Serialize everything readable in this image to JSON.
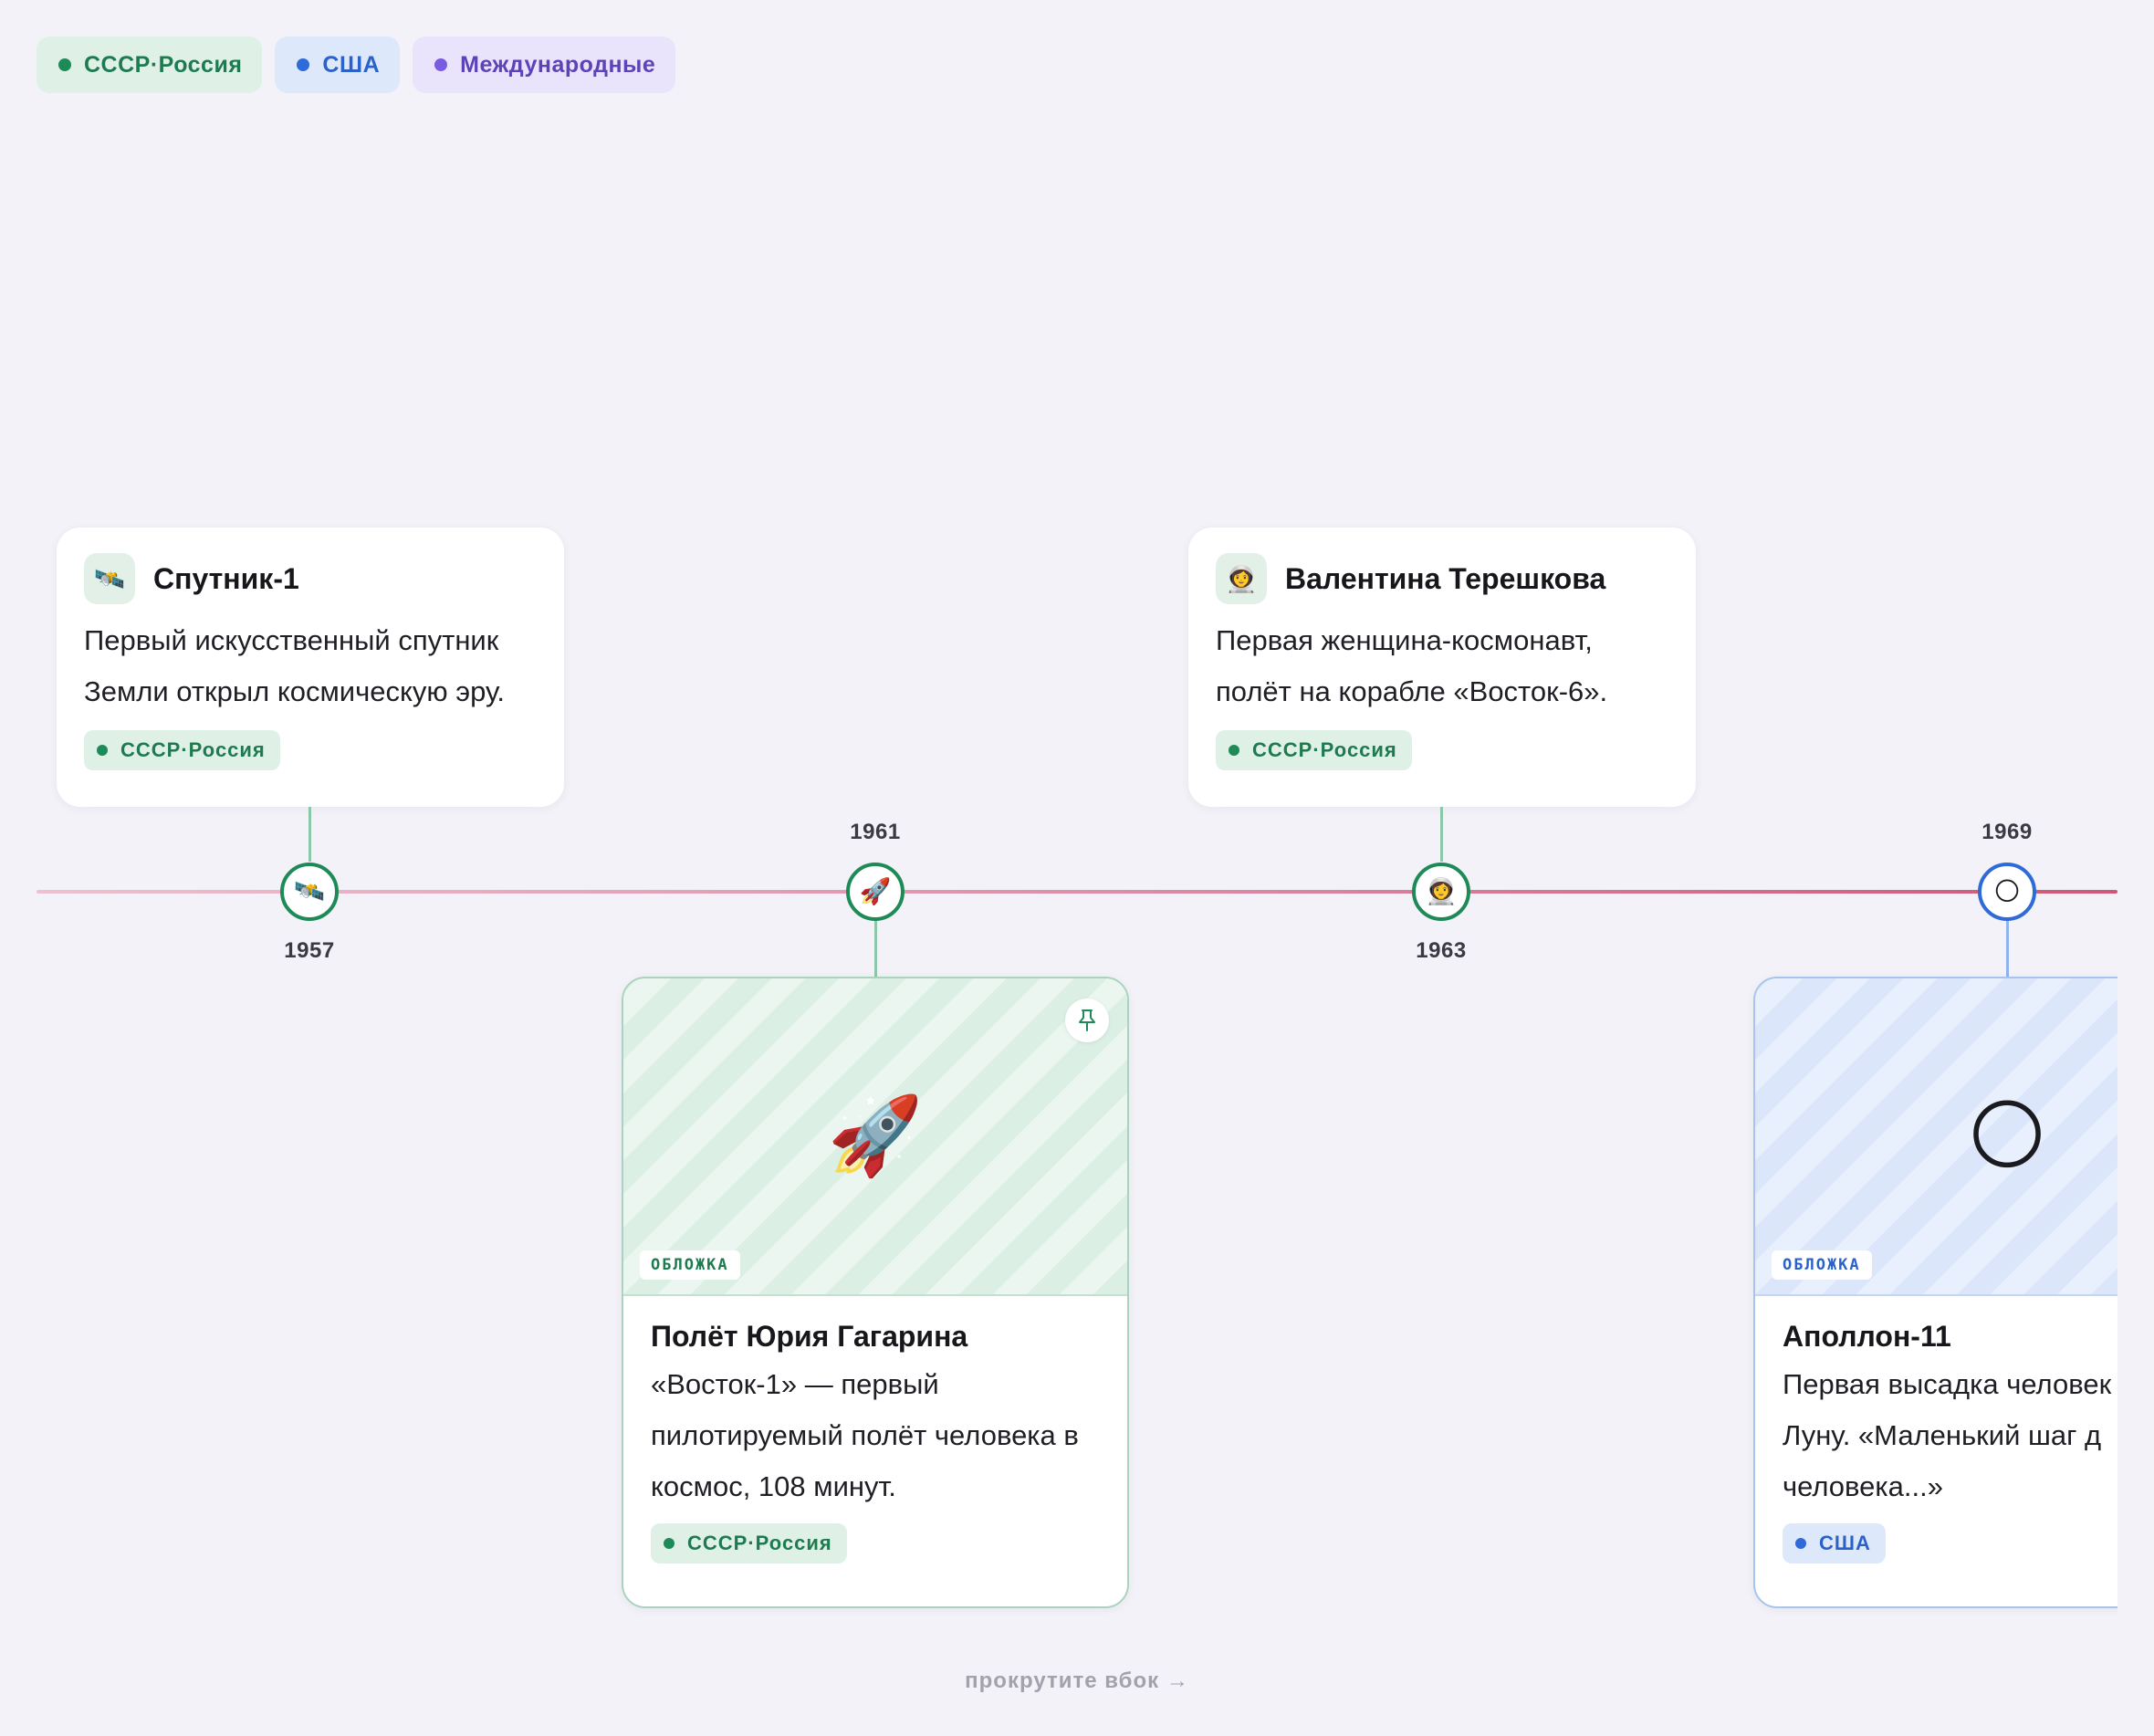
{
  "legend": [
    {
      "label": "СССР·Россия",
      "color": "#1e8a57"
    },
    {
      "label": "США",
      "color": "#2f6ad9"
    },
    {
      "label": "Международные",
      "color": "#7a5ce0"
    }
  ],
  "events": [
    {
      "year": "1957",
      "icon": "satellite-icon",
      "emoji": "🛰️",
      "title": "Спутник-1",
      "description": "Первый искусственный спутник Земли открыл космическую эру.",
      "tag": "СССР·Россия"
    },
    {
      "year": "1961",
      "icon": "rocket-icon",
      "emoji": "🚀",
      "cover_label": "ОБЛОЖКА",
      "title": "Полёт Юрия Гагарина",
      "description": "«Восток-1» — первый пилотируемый полёт человека в космос, 108 минут.",
      "tag": "СССР·Россия"
    },
    {
      "year": "1963",
      "icon": "astronaut-icon",
      "emoji": "👩‍🚀",
      "title": "Валентина Терешкова",
      "description": "Первая женщина-космонавт, полёт на корабле «Восток-6».",
      "tag": "СССР·Россия"
    },
    {
      "year": "1969",
      "icon": "moon-icon",
      "emoji": "🌕",
      "cover_label": "ОБЛОЖКА",
      "title": "Аполлон-11",
      "description_lines": [
        "Первая высадка человек",
        "Луну. «Маленький шаг д",
        "человека...»"
      ],
      "tag": "США"
    }
  ],
  "scroll_hint": "прокрутите вбок →"
}
